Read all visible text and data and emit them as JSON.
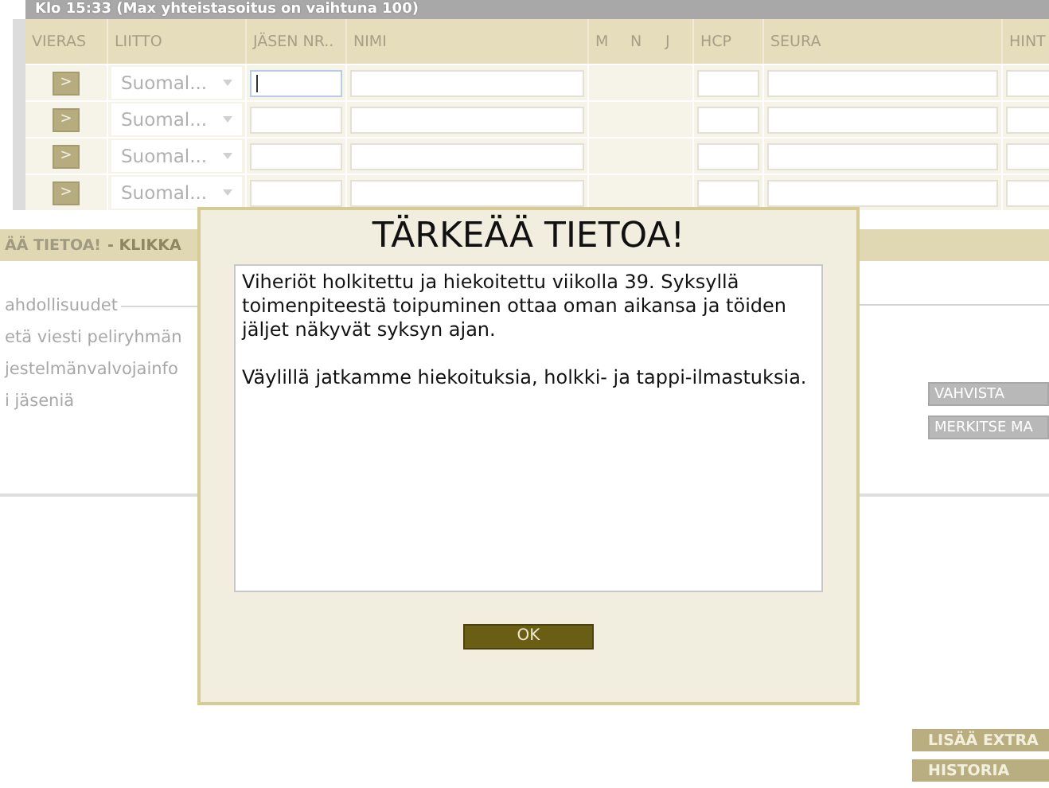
{
  "top_bar": {
    "title": "Klo 15:33 (Max yhteistasoitus on vaihtuna 100)"
  },
  "table": {
    "columns": [
      "VIERAS",
      "LIITTO",
      "JÄSEN NR..",
      "NIMI",
      "M",
      "N",
      "J",
      "HCP",
      "SEURA",
      "HINT"
    ],
    "rows": [
      {
        "guest_button": ">",
        "liitto": "Suomal...",
        "member_focused": true
      },
      {
        "guest_button": ">",
        "liitto": "Suomal...",
        "member_focused": false
      },
      {
        "guest_button": ">",
        "liitto": "Suomal...",
        "member_focused": false
      },
      {
        "guest_button": ">",
        "liitto": "Suomal...",
        "member_focused": false
      }
    ]
  },
  "notice_bar": {
    "title": "ÄÄ TIETOA!",
    "link": "- KLIKKA"
  },
  "options": {
    "legend": "ahdollisuudet",
    "links": [
      "etä viesti peliryhmän",
      "jestelmänvalvojainfo",
      "i jäseniä"
    ],
    "buttons": [
      "VAHVISTA",
      "MERKITSE MA"
    ]
  },
  "bottom_buttons": [
    "LISÄÄ EXTRA",
    "HISTORIA"
  ],
  "dialog": {
    "title": "TÄRKEÄÄ TIETOA!",
    "paragraphs": [
      "Viheriöt holkitettu ja hiekoitettu viikolla 39. Syksyllä toimenpiteestä toipuminen ottaa oman aikansa ja töiden jäljet näkyvät syksyn ajan.",
      "Väylillä jatkamme hiekoituksia, holkki- ja tappi-ilmastuksia."
    ],
    "button": "OK"
  }
}
